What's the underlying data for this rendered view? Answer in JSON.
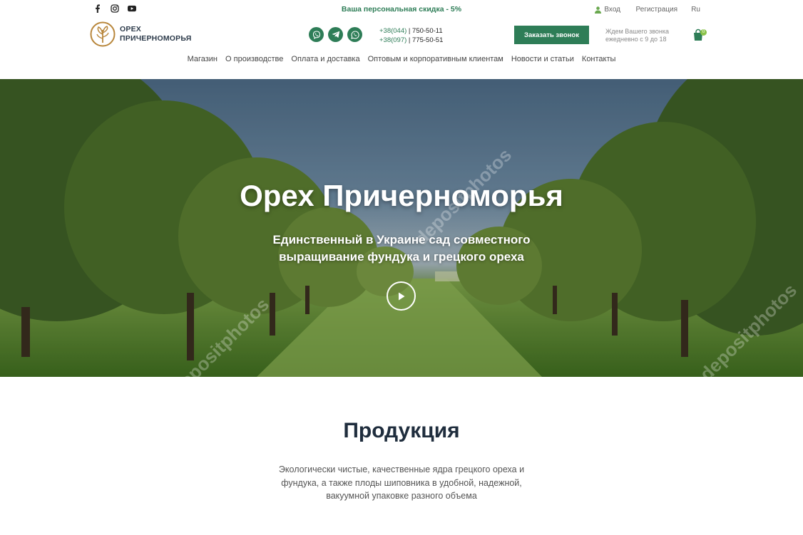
{
  "topbar": {
    "social_icons": [
      "facebook-icon",
      "instagram-icon",
      "youtube-icon"
    ],
    "discount": "Ваша персональная скидка - 5%",
    "login": "Вход",
    "register": "Регистрация",
    "language": "Ru"
  },
  "header": {
    "logo_line1": "ОРЕХ",
    "logo_line2": "ПРИЧЕРНОМОРЬЯ",
    "messengers": [
      "viber-icon",
      "telegram-icon",
      "whatsapp-icon"
    ],
    "phone1_code": "+38(044)",
    "phone1_number": " | 750-50-11",
    "phone2_code": "+38(097)",
    "phone2_number": " | 775-50-51",
    "call_button": "Заказать звонок",
    "call_note_line1": "Ждем Вашего звонка",
    "call_note_line2": "ежедневно с 9 до 18",
    "cart_count": "0"
  },
  "nav": {
    "items": [
      "Магазин",
      "О производстве",
      "Оплата и доставка",
      "Оптовым и корпоративным клиентам",
      "Новости и статьи",
      "Контакты"
    ]
  },
  "hero": {
    "title": "Орех Причерноморья",
    "subtitle": "Единственный в Украине сад совместного выращивание фундука и грецкого ореха",
    "watermark": "depositphotos"
  },
  "products": {
    "title": "Продукция",
    "description": "Экологически чистые, качественные ядра грецкого ореха и фундука, а также плоды шиповника в удобной, надежной, вакуумной упаковке разного объема"
  },
  "colors": {
    "accent": "#2e7d57",
    "heading": "#1f2d3d",
    "badge": "#8bc34a"
  }
}
